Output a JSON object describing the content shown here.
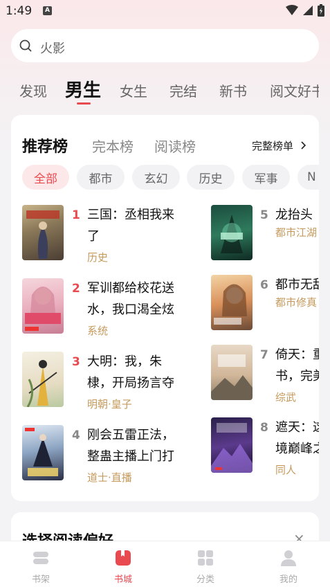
{
  "status": {
    "time": "1:49",
    "notif": "A"
  },
  "search": {
    "placeholder": "火影"
  },
  "tabs": [
    "发现",
    "男生",
    "女生",
    "完结",
    "新书",
    "阅文好书"
  ],
  "rank": {
    "tabs": [
      "推荐榜",
      "完本榜",
      "阅读榜"
    ],
    "full_list": "完整榜单",
    "chips": [
      "全部",
      "都市",
      "玄幻",
      "历史",
      "军事",
      "N"
    ],
    "books_left": [
      {
        "num": "1",
        "title": "三国：丞相我来了",
        "tag": "历史"
      },
      {
        "num": "2",
        "title": "军训都给校花送水，我口渴全炫",
        "tag": "系统"
      },
      {
        "num": "3",
        "title": "大明：我，朱棣，开局扬言夺",
        "tag": "明朝·皇子"
      },
      {
        "num": "4",
        "title": "刚会五雷正法，整蛊主播上门打",
        "tag": "道士·直播"
      }
    ],
    "books_right": [
      {
        "num": "5",
        "title": "龙抬头",
        "tag": "都市江湖"
      },
      {
        "num": "6",
        "title": "都市无敌",
        "tag": "都市修真"
      },
      {
        "num": "7",
        "title": "倚天：重书，完美",
        "tag": "综武"
      },
      {
        "num": "8",
        "title": "遮天：这境巅峰之",
        "tag": "同人"
      }
    ]
  },
  "preference": {
    "title": "选择阅读偏好",
    "close": "×"
  },
  "nav": [
    {
      "label": "书架"
    },
    {
      "label": "书城"
    },
    {
      "label": "分类"
    },
    {
      "label": "我的"
    }
  ],
  "colors": {
    "accent": "#e94a50",
    "tag": "#c59a5c"
  }
}
